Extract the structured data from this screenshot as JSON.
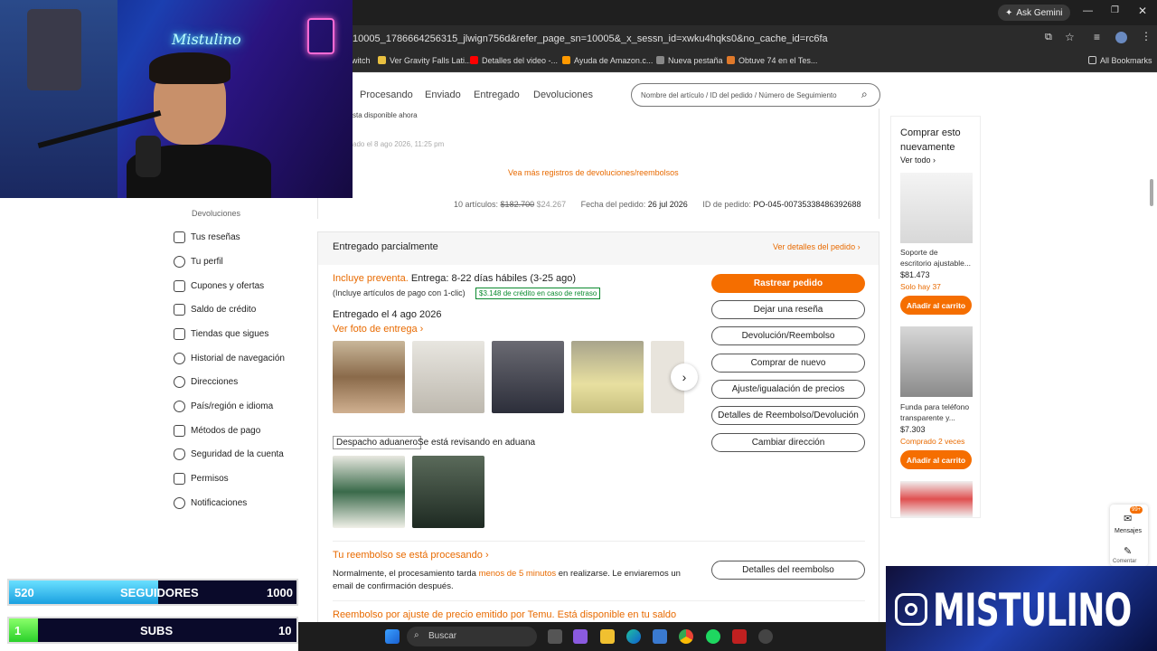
{
  "browser": {
    "ask_gemini": "Ask Gemini",
    "url": "10005_1786664256315_jlwign756d&refer_page_sn=10005&_x_sessn_id=xwku4hqks0&no_cache_id=rc6fa",
    "bookmarks": [
      {
        "label": "witch",
        "color": "#9146ff"
      },
      {
        "label": "Ver Gravity Falls Lati...",
        "color": "#e8c040"
      },
      {
        "label": "Detalles del video -...",
        "color": "#ff0000"
      },
      {
        "label": "Ayuda de Amazon.c...",
        "color": "#ff9900"
      },
      {
        "label": "Nueva pestaña",
        "color": "#888888"
      },
      {
        "label": "Obtuve 74 en el Tes...",
        "color": "#e0792a"
      }
    ],
    "all_bookmarks": "All Bookmarks"
  },
  "webcam": {
    "neon_sign": "Mistulino"
  },
  "header": {
    "tabs": [
      "Procesando",
      "Enviado",
      "Entregado",
      "Devoluciones"
    ],
    "search_placeholder": "Nombre del artículo / ID del pedido / Número de Seguimiento"
  },
  "sidebar": {
    "top_label": "Devoluciones",
    "items": [
      "Tus reseñas",
      "Tu perfil",
      "Cupones y ofertas",
      "Saldo de crédito",
      "Tiendas que sigues",
      "Historial de navegación",
      "Direcciones",
      "País/región e idioma",
      "Métodos de pago",
      "Seguridad de la cuenta",
      "Permisos",
      "Notificaciones"
    ]
  },
  "order_prev": {
    "avail_text": "sta disponible ahora",
    "date_text": "ado el 8 ago 2026, 11:25 pm",
    "more_returns": "Vea más registros de devoluciones/reembolsos",
    "articles": "10 artículos:",
    "old_price": "$182.700",
    "new_price": "$24.267",
    "order_date_label": "Fecha del pedido:",
    "order_date": "26 jul 2026",
    "order_id_label": "ID de pedido:",
    "order_id": "PO-045-00735338486392688"
  },
  "order": {
    "status": "Entregado parcialmente",
    "details_link": "Ver detalles del pedido",
    "presale": "Incluye preventa.",
    "delivery": "Entrega: 8-22 días hábiles (3-25 ago)",
    "oneclick": "(Incluye artículos de pago con 1-clic)",
    "credit_badge": "$3.148 de crédito en caso de retraso",
    "delivered": "Entregado el 4 ago 2026",
    "photo_link": "Ver foto de entrega",
    "customs_badge": "Despacho aduanero",
    "customs_text": "Se está revisando en aduana",
    "buttons": {
      "track": "Rastrear pedido",
      "review": "Dejar una reseña",
      "return": "Devolución/Reembolso",
      "buy_again": "Comprar de nuevo",
      "price_adjust": "Ajuste/igualación de precios",
      "refund_details": "Detalles de Reembolso/Devolución",
      "change_address": "Cambiar dirección"
    },
    "refund_title": "Tu reembolso se está procesando",
    "refund_text_1": "Normalmente, el procesamiento tarda",
    "refund_text_highlight": "menos de 5 minutos",
    "refund_text_2": "en realizarse. Le enviaremos un",
    "refund_text_3": "email de confirmación después.",
    "refund_button": "Detalles del reembolso",
    "adjust_refund": "Reembolso por ajuste de precio emitido por Temu. Está disponible en tu saldo"
  },
  "buy_again_panel": {
    "title_1": "Comprar esto",
    "title_2": "nuevamente",
    "see_all": "Ver todo",
    "products": [
      {
        "name_1": "Soporte de",
        "name_2": "escritorio ajustable...",
        "price": "$81.473",
        "note": "Solo hay 37",
        "add": "Añadir al carrito"
      },
      {
        "name_1": "Funda para teléfono",
        "name_2": "transparente y...",
        "price": "$7.303",
        "note": "Comprado 2 veces",
        "add": "Añadir al carrito"
      }
    ]
  },
  "float": {
    "messages": "Mensajes",
    "badge": "99+",
    "comments": "Comentar"
  },
  "taskbar": {
    "search": "Buscar"
  },
  "overlay": {
    "followers_current": "520",
    "followers_label": "SEGUIDORES",
    "followers_goal": "1000",
    "followers_progress": 0.52,
    "subs_current": "1",
    "subs_label": "SUBS",
    "subs_goal": "10",
    "subs_progress": 0.1,
    "brand": "MISTULINO"
  }
}
